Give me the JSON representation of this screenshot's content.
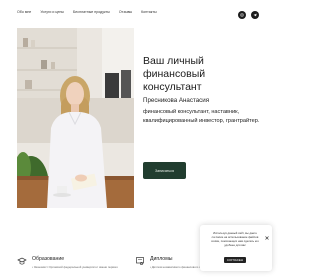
{
  "nav": {
    "items": [
      {
        "label": "Обо мне"
      },
      {
        "label": "Услуги и цены"
      },
      {
        "label": "Бесплатные продукты"
      },
      {
        "label": "Отзывы"
      },
      {
        "label": "Контакты"
      }
    ]
  },
  "social": {
    "items": [
      {
        "icon": "instagram-icon"
      },
      {
        "icon": "telegram-icon"
      }
    ]
  },
  "hero": {
    "title": "Ваш личный финансовый консультант",
    "name": "Пресникова Анастасия",
    "bio": "финансовый консультант, наставник, квалифицированный инвестор, грантрайтер.",
    "cta_label": "Записаться"
  },
  "features": [
    {
      "icon": "education-icon",
      "title": "Образование",
      "text": "• Экономист Орловской федеральной университет имени первого"
    },
    {
      "icon": "diploma-icon",
      "title": "Дипломы",
      "text": "• Диплом независимого финансового советника • ВУ Education"
    }
  ],
  "cookie": {
    "text": "Используя данный сайт, вы даете согласие на использование файлов cookie, помогающих нам сделать его удобнее для вас",
    "accept_label": "СОГЛАСЕН"
  },
  "colors": {
    "accent": "#213d2f",
    "dark": "#1c1c1c"
  }
}
